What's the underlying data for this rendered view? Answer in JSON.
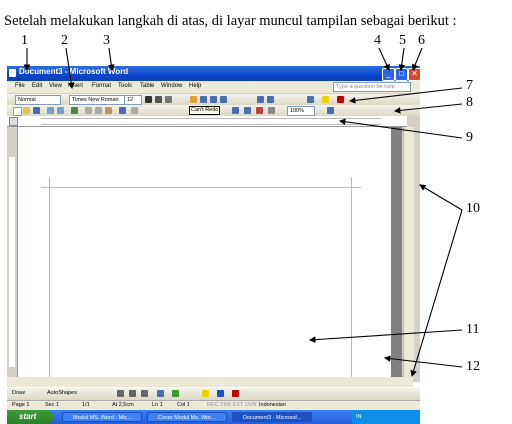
{
  "caption": "Setelah melakukan langkah di atas, di layar  muncul tampilan sebagai berikut :",
  "callouts": [
    "1",
    "2",
    "3",
    "4",
    "5",
    "6",
    "7",
    "8",
    "9",
    "10",
    "11",
    "12"
  ],
  "window": {
    "title": "Document3 - Microsoft Word",
    "menus": [
      "File",
      "Edit",
      "View",
      "Insert",
      "Format",
      "Tools",
      "Table",
      "Window",
      "Help"
    ],
    "help_placeholder": "Type a question for help",
    "style": "Normal",
    "font": "Times New Roman",
    "size": "12",
    "zoom": "100%",
    "tooltip": "Can't Redo",
    "draw_label": "Draw",
    "autoshapes_label": "AutoShapes",
    "status": {
      "page": "Page 1",
      "sec": "Sec 1",
      "pages": "1/1",
      "at": "At 2,5cm",
      "ln": "Ln 1",
      "col": "Col 1",
      "flags": "REC TRK EXT OVR",
      "lang": "Indonesian"
    },
    "taskbar": {
      "start": "start",
      "tasks": [
        "Modul MS. Word - Mic...",
        "Cover Modul Ms. Wor...",
        "Document3 - Microsof..."
      ],
      "tray": "IN"
    }
  },
  "colors": {
    "title_bar": "#0a46c8",
    "start": "#2c7e2b",
    "taskbar": "#245edb"
  }
}
